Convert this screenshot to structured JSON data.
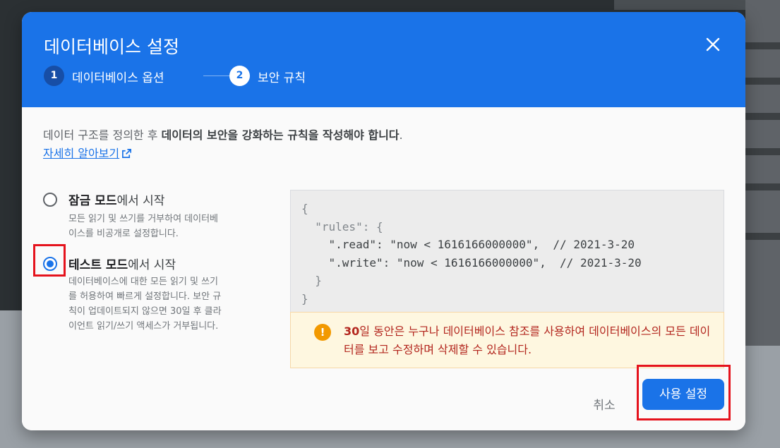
{
  "dialog": {
    "title": "데이터베이스 설정",
    "close_icon": "close-icon"
  },
  "steps": [
    {
      "number": "1",
      "label": "데이터베이스 옵션",
      "state": "completed"
    },
    {
      "number": "2",
      "label": "보안 규칙",
      "state": "active"
    }
  ],
  "intro": {
    "text_plain": "데이터 구조를 정의한 후 ",
    "text_bold": "데이터의 보안을 강화하는 규칙을 작성해야 합니다",
    "text_end": ".",
    "learn_more": "자세히 알아보기",
    "learn_more_icon": "external-link-icon"
  },
  "modes": [
    {
      "bold": "잠금 모드",
      "rest": "에서 시작",
      "description_line1": "모든 읽기 및 쓰기를 거부하여 데이터베",
      "description_line2": "이스를 비공개로 설정합니다.",
      "checked": false
    },
    {
      "bold": "테스트 모드",
      "rest": "에서 시작",
      "description_line1": "데이터베이스에 대한 모든 읽기 및 쓰기",
      "description_line2": "를 허용하여 빠르게 설정합니다. 보안 규",
      "description_line3": "칙이 업데이트되지 않으면 30일 후 클라",
      "description_line4": "이언트 읽기/쓰기 액세스가 거부됩니다.",
      "checked": true
    }
  ],
  "code": {
    "line1": "{",
    "line2": "  \"rules\": {",
    "line3": "    \".read\": \"now < 1616166000000\",  // 2021-3-20",
    "line4": "    \".write\": \"now < 1616166000000\",  // 2021-3-20",
    "line5": "  }",
    "line6": "}"
  },
  "warning": {
    "icon": "!",
    "bold": "30",
    "text": "일 동안은 누구나 데이터베이스 참조를 사용하여 데이터베이스의 모든 데이터를 보고 수정하며 삭제할 수 있습니다."
  },
  "actions": {
    "cancel": "취소",
    "enable": "사용 설정"
  }
}
